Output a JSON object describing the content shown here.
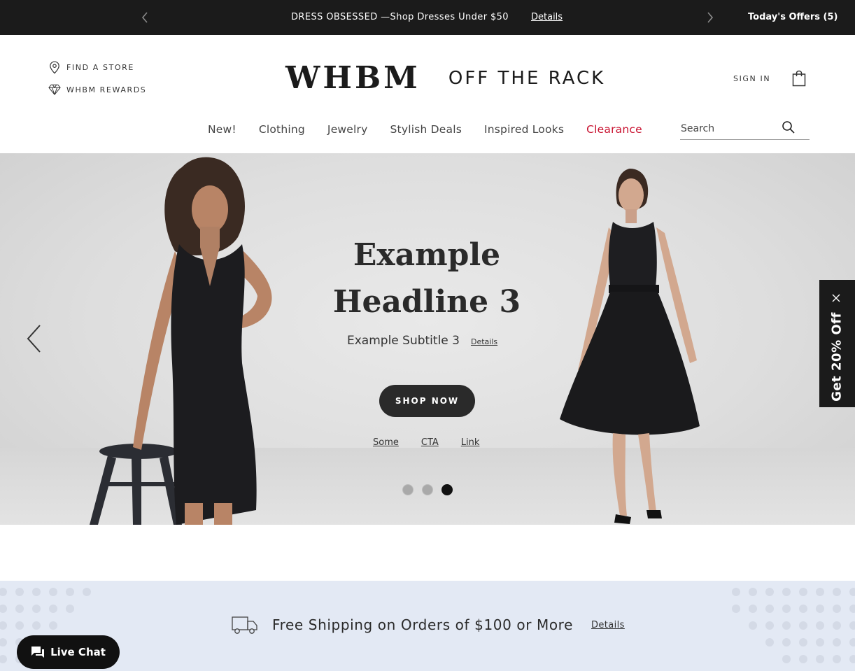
{
  "promo_bar": {
    "message": "DRESS OBSESSED —Shop Dresses Under $50",
    "details_label": "Details",
    "offers_label": "Today's Offers (5)",
    "prev_icon": "chevron-left-icon",
    "next_icon": "chevron-right-icon"
  },
  "header": {
    "find_store_label": "FIND A STORE",
    "rewards_label": "WHBM REWARDS",
    "logo_primary": "WHBM",
    "logo_secondary": "OFF THE RACK",
    "sign_in_label": "SIGN IN",
    "bag_icon": "shopping-bag-icon"
  },
  "nav": {
    "items": [
      {
        "label": "New!"
      },
      {
        "label": "Clothing"
      },
      {
        "label": "Jewelry"
      },
      {
        "label": "Stylish Deals"
      },
      {
        "label": "Inspired Looks"
      },
      {
        "label": "Clearance",
        "color": "#c8102e"
      }
    ]
  },
  "search": {
    "placeholder": "Search",
    "icon": "search-icon"
  },
  "hero": {
    "headline": "Example Headline 3",
    "subtitle": "Example Subtitle 3",
    "details_label": "Details",
    "shop_now_label": "SHOP NOW",
    "cta_links": [
      "Some",
      "CTA",
      "Link"
    ],
    "slide_count": 3,
    "active_slide": 3
  },
  "side_tab": {
    "label": "Get 20% Off",
    "close_icon": "close-icon"
  },
  "shipping": {
    "text": "Free Shipping on Orders of $100 or More",
    "details_label": "Details",
    "icon": "truck-icon"
  },
  "live_chat": {
    "label": "Live Chat",
    "icon": "chat-icon"
  },
  "colors": {
    "promo_bg": "#1b1b1b",
    "accent_red": "#c8102e",
    "shipping_bg": "#e3e9f4"
  }
}
